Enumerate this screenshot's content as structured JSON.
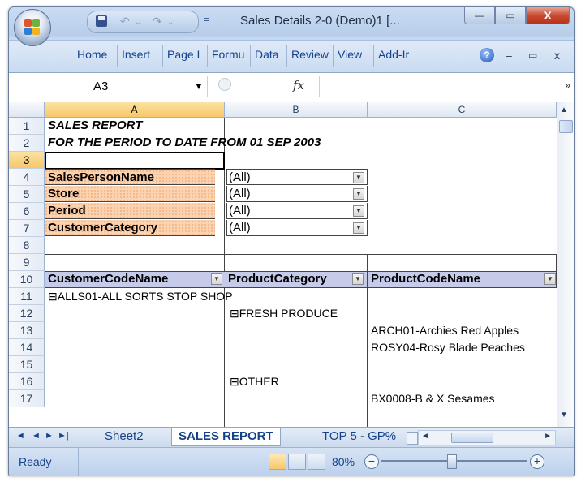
{
  "window": {
    "title": "Sales Details 2-0 (Demo)1  [...",
    "controls": {
      "minimize": "—",
      "maximize": "▭",
      "close": "X"
    }
  },
  "quick_access": {
    "undo": "↶",
    "redo": "↷",
    "customize": "="
  },
  "ribbon": {
    "tabs": [
      "Home",
      "Insert",
      "Page L",
      "Formu",
      "Data",
      "Review",
      "View",
      "Add-Ir"
    ],
    "help": "?",
    "doc_controls": {
      "minimize": "–",
      "restore": "▭",
      "close": "x"
    }
  },
  "formula_bar": {
    "name_box": "A3",
    "fx": "fx",
    "formula": "",
    "expand": "»"
  },
  "columns": {
    "a": "A",
    "b": "B",
    "c": "C"
  },
  "rows": [
    "1",
    "2",
    "3",
    "4",
    "5",
    "6",
    "7",
    "8",
    "9",
    "10",
    "11",
    "12",
    "13",
    "14",
    "15",
    "16",
    "17"
  ],
  "report": {
    "title": "SALES REPORT",
    "period": "FOR THE PERIOD TO DATE FROM  01 SEP 2003",
    "filters": [
      {
        "label": "SalesPersonName",
        "value": "(All)"
      },
      {
        "label": "Store",
        "value": "(All)"
      },
      {
        "label": "Period",
        "value": "(All)"
      },
      {
        "label": "CustomerCategory",
        "value": "(All)"
      }
    ],
    "headers": {
      "a": "CustomerCodeName",
      "b": "ProductCategory",
      "c": "ProductCodeName"
    },
    "row11": "⊟ALLS01-ALL SORTS STOP SHOP",
    "row12": "⊟FRESH PRODUCE",
    "row13": "ARCH01-Archies Red Apples",
    "row14": "ROSY04-Rosy Blade Peaches",
    "row16": "⊟OTHER",
    "row17": "BX0008-B & X Sesames"
  },
  "sheets": {
    "nav": [
      "◄◄",
      "◄",
      "►",
      "►►"
    ],
    "tabs": [
      "Sheet2",
      "SALES REPORT",
      "TOP 5 - GP%"
    ],
    "active": "SALES REPORT"
  },
  "status": {
    "ready": "Ready",
    "zoom": "80%"
  }
}
